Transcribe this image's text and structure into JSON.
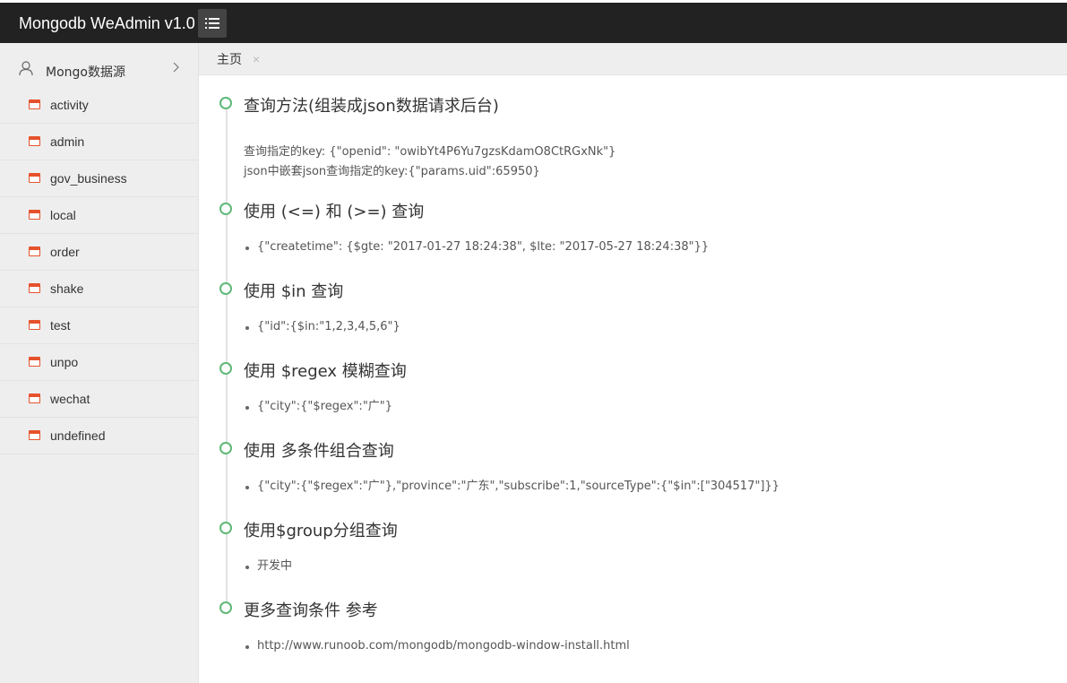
{
  "app": {
    "title": "Mongodb WeAdmin v1.0"
  },
  "sidebar": {
    "header": "Mongo数据源",
    "items": [
      {
        "label": "activity"
      },
      {
        "label": "admin"
      },
      {
        "label": "gov_business"
      },
      {
        "label": "local"
      },
      {
        "label": "order"
      },
      {
        "label": "shake"
      },
      {
        "label": "test"
      },
      {
        "label": "unpo"
      },
      {
        "label": "wechat"
      },
      {
        "label": "undefined"
      }
    ]
  },
  "tabs": [
    {
      "label": "主页",
      "close": "×"
    }
  ],
  "timeline": [
    {
      "title": "查询方法(组装成json数据请求后台)",
      "lines": [
        "查询指定的key: {\"openid\": \"owibYt4P6Yu7gzsKdamO8CtRGxNk\"}",
        "json中嵌套json查询指定的key:{\"params.uid\":65950}"
      ]
    },
    {
      "title": "使用 (<=) 和 (>=) 查询",
      "bullets": [
        "{\"createtime\": {$gte: \"2017-01-27 18:24:38\", $lte: \"2017-05-27 18:24:38\"}}"
      ]
    },
    {
      "title": "使用 $in 查询",
      "bullets": [
        "{\"id\":{$in:\"1,2,3,4,5,6\"}"
      ]
    },
    {
      "title": "使用 $regex 模糊查询",
      "bullets": [
        "{\"city\":{\"$regex\":\"广\"}"
      ]
    },
    {
      "title": "使用 多条件组合查询",
      "bullets": [
        "{\"city\":{\"$regex\":\"广\"},\"province\":\"广东\",\"subscribe\":1,\"sourceType\":{\"$in\":[\"304517\"]}}"
      ]
    },
    {
      "title": "使用$group分组查询",
      "bullets": [
        "开发中"
      ]
    },
    {
      "title": "更多查询条件 参考",
      "bullets": [
        "http://www.runoob.com/mongodb/mongodb-window-install.html"
      ]
    }
  ],
  "colors": {
    "topbar": "#222222",
    "sidebar_bg": "#eeeeee",
    "accent_green": "#5fb878",
    "table_icon": "#e5522c"
  }
}
